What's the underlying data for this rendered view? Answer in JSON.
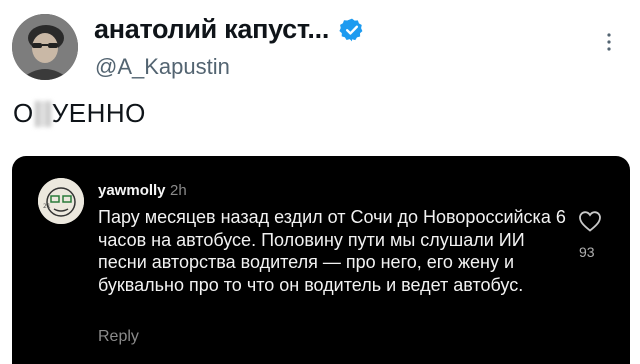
{
  "tweet": {
    "display_name": "анатолий капуст...",
    "handle": "@A_Kapustin",
    "text_prefix": "О",
    "text_suffix": "УЕННО"
  },
  "icons": {
    "verified": "verified-badge-icon",
    "more": "more-vertical-icon",
    "like": "heart-icon"
  },
  "embedded_comment": {
    "username": "yawmolly",
    "time": "2h",
    "text": "Пару месяцев назад ездил от Сочи до Новороссийска 6 часов на автобусе. Половину пути мы слушали ИИ песни авторства водителя — про него, его жену и буквально про то что он водитель и ведет автобус.",
    "reply_label": "Reply",
    "like_count": "93"
  },
  "colors": {
    "verified_blue": "#1d9bf0",
    "card_background": "#000000",
    "handle_gray": "#536471"
  }
}
